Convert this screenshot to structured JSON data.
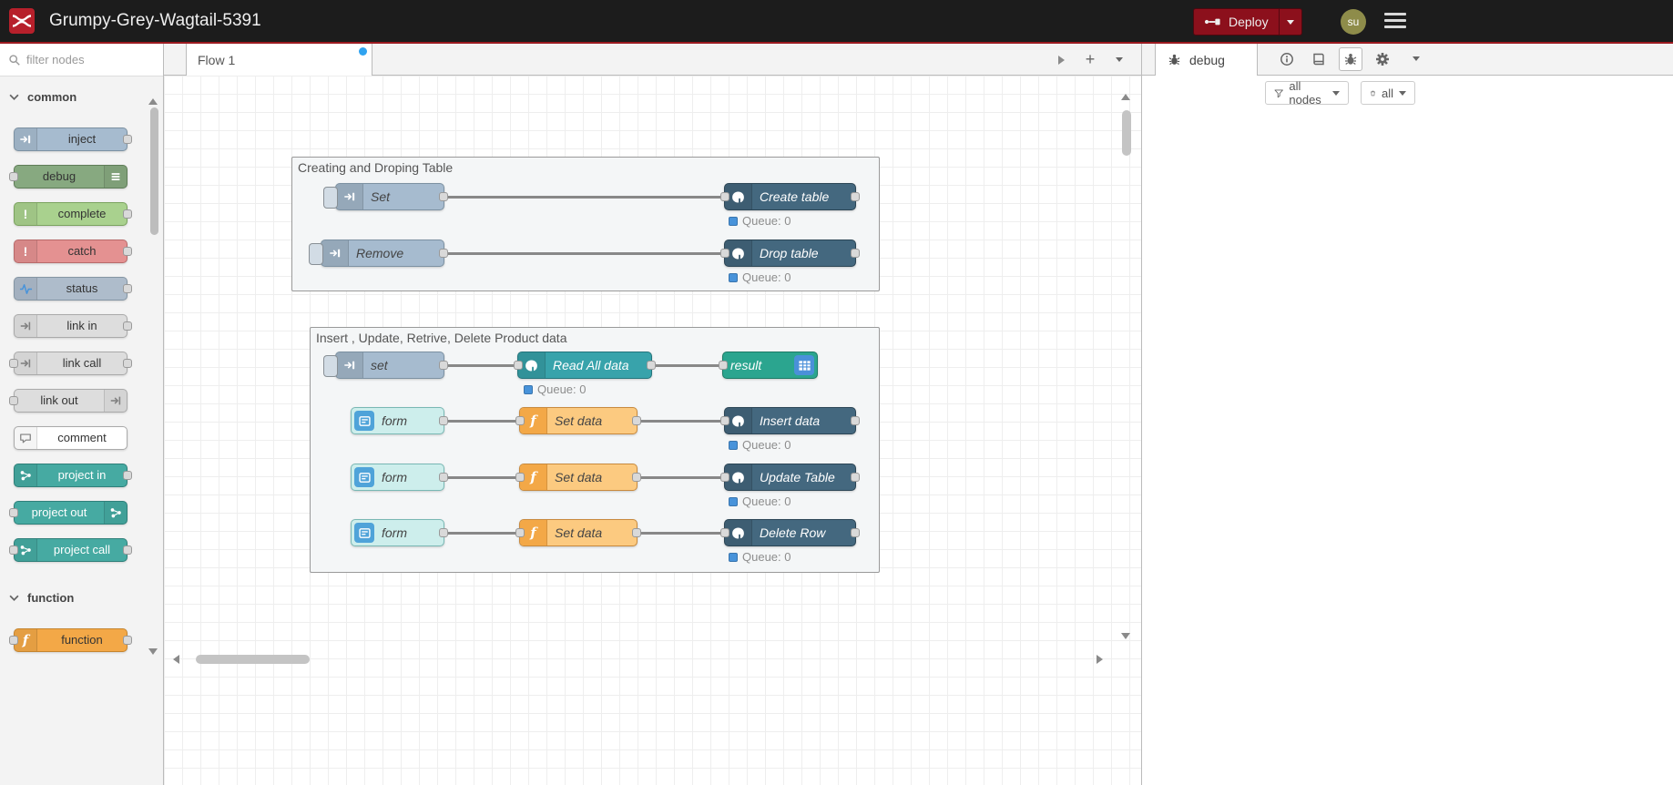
{
  "header": {
    "title": "Grumpy-Grey-Wagtail-5391",
    "deploy": "Deploy",
    "user": "su"
  },
  "palette": {
    "filter_placeholder": "filter nodes",
    "categories": [
      {
        "label": "common"
      },
      {
        "label": "function"
      }
    ],
    "common": [
      {
        "label": "inject"
      },
      {
        "label": "debug"
      },
      {
        "label": "complete"
      },
      {
        "label": "catch"
      },
      {
        "label": "status"
      },
      {
        "label": "link in"
      },
      {
        "label": "link call"
      },
      {
        "label": "link out"
      },
      {
        "label": "comment"
      },
      {
        "label": "project in"
      },
      {
        "label": "project out"
      },
      {
        "label": "project call"
      }
    ],
    "function_nodes": [
      {
        "label": "function"
      }
    ]
  },
  "workspace": {
    "tab": "Flow 1",
    "add_label": "+",
    "queue_label": "Queue: 0",
    "groups": [
      {
        "label": "Creating and Droping Table"
      },
      {
        "label": "Insert , Update, Retrive, Delete Product data"
      }
    ],
    "nodes": [
      {
        "label": "Set"
      },
      {
        "label": "Create table"
      },
      {
        "label": "Remove"
      },
      {
        "label": "Drop table"
      },
      {
        "label": "set"
      },
      {
        "label": "Read All data"
      },
      {
        "label": "result"
      },
      {
        "label": "form"
      },
      {
        "label": "Set data"
      },
      {
        "label": "Insert data"
      },
      {
        "label": "form"
      },
      {
        "label": "Set data"
      },
      {
        "label": "Update Table"
      },
      {
        "label": "form"
      },
      {
        "label": "Set data"
      },
      {
        "label": "Delete Row"
      }
    ]
  },
  "sidebar": {
    "tab": "debug",
    "filter": "all nodes",
    "clear": "all"
  },
  "colors": {
    "header_bg": "#1c1c1c",
    "header_line": "#9b1a20",
    "deploy_bg": "#8C101C",
    "avatar_bg": "#8e8c4a",
    "tab_dot": "#2fa3f0",
    "node_inject": "#a6bbcf",
    "node_debug": "#87a980",
    "node_complete": "#a9d18e",
    "node_catch": "#e49191",
    "node_status": "#aebccb",
    "node_link": "#dddddd",
    "node_comment": "#ffffff",
    "node_project": "#46aaa2",
    "node_function": "#f3a847",
    "node_function_light": "#fcca80",
    "node_postgres": "#44687f",
    "node_postgres_teal": "#38a3ab",
    "node_result": "#2ba58f",
    "node_form": "#cdeeec",
    "node_form_icon": "#4fa3d9",
    "table_icon_bg": "#4a90d9",
    "status_blue": "#4893da",
    "wire": "#888888",
    "port_bg": "#d9d9d9",
    "port_border": "#999999"
  }
}
